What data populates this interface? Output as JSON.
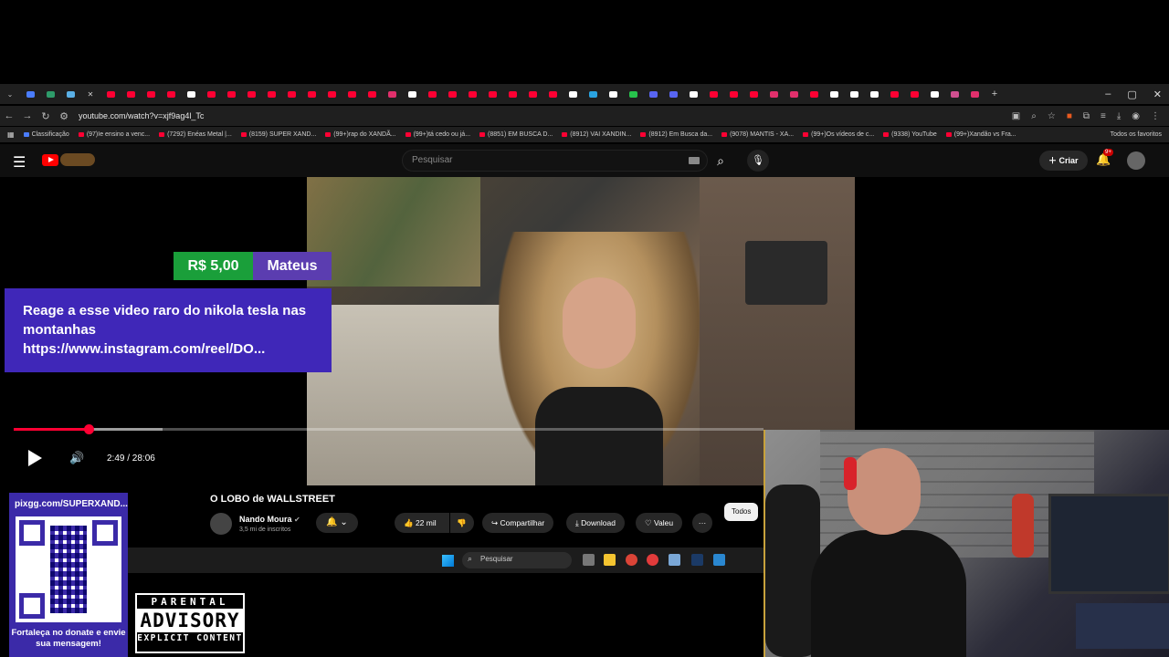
{
  "browser": {
    "url": "youtube.com/watch?v=xjf9ag4l_Tc",
    "bookmarks": [
      "Classificação",
      "(97)Ie ensino a venc...",
      "(7292) Enéas Metal |...",
      "(8159) SUPER XAND...",
      "(99+)rap do XANDÃ...",
      "(99+)tá cedo ou já...",
      "(8851) EM BUSCA D...",
      "(8912) VAI XANDIN...",
      "(8912) Em Busca da...",
      "(9078) MANTIS - XA...",
      "(99+)Os vídeos de c...",
      "(9338) YouTube",
      "(99+)Xandão vs Fra..."
    ],
    "all_favorites": "Todos os favoritos"
  },
  "youtube": {
    "search_placeholder": "Pesquisar",
    "create_label": "Criar",
    "notifications_badge": "9+"
  },
  "player": {
    "time": "2:49 / 28:06",
    "progress_fraction": 0.1,
    "buffer_fraction": 0.198
  },
  "donation": {
    "amount": "R$ 5,00",
    "name": "Mateus",
    "message": "Reage a esse video raro do nikola tesla nas montanhas https://www.instagram.com/reel/DO..."
  },
  "video": {
    "title": "O LOBO de WALLSTREET",
    "channel": "Nando Moura",
    "subscribers": "3,5 mi de inscritos",
    "likes": "22 mil",
    "share_label": "Compartilhar",
    "download_label": "Download",
    "valeu_label": "Valeu",
    "chip_label": "Todos"
  },
  "taskbar": {
    "search_placeholder": "Pesquisar"
  },
  "qr_panel": {
    "url": "pixgg.com/SUPERXAND...",
    "caption": "Fortaleça no donate e envie sua mensagem!"
  },
  "advisory": {
    "line1": "PARENTAL",
    "line2": "ADVISORY",
    "line3": "EXPLICIT CONTENT"
  },
  "colors": {
    "accent_red": "#ff0033",
    "donation_green": "#1a9f3a",
    "donation_purple": "#5b3db0",
    "message_purple": "#3f27b8"
  }
}
